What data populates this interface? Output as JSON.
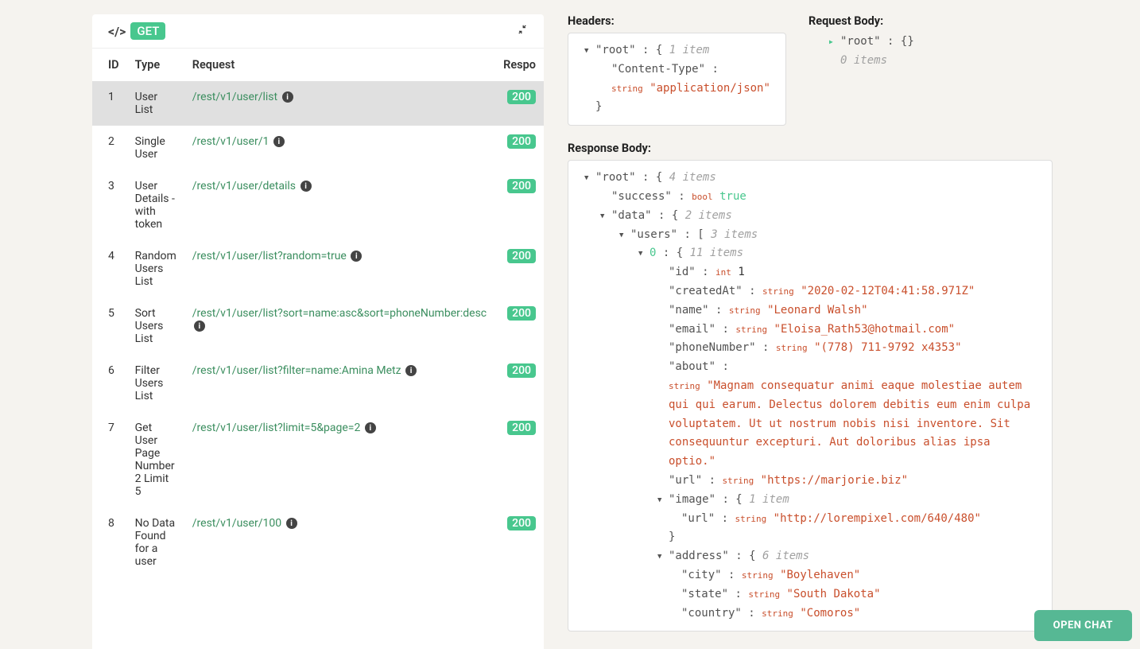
{
  "method_badge": "GET",
  "table": {
    "headers": {
      "id": "ID",
      "type": "Type",
      "request": "Request",
      "response": "Respo"
    },
    "rows": [
      {
        "id": "1",
        "type": "User List",
        "request": "/rest/v1/user/list",
        "response": "200",
        "selected": true
      },
      {
        "id": "2",
        "type": "Single User",
        "request": "/rest/v1/user/1",
        "response": "200"
      },
      {
        "id": "3",
        "type": "User Details - with token",
        "request": "/rest/v1/user/details",
        "response": "200"
      },
      {
        "id": "4",
        "type": "Random Users List",
        "request": "/rest/v1/user/list?random=true",
        "response": "200"
      },
      {
        "id": "5",
        "type": "Sort Users List",
        "request": "/rest/v1/user/list?sort=name:asc&sort=phoneNumber:desc",
        "response": "200"
      },
      {
        "id": "6",
        "type": "Filter Users List",
        "request": "/rest/v1/user/list?filter=name:Amina Metz",
        "response": "200"
      },
      {
        "id": "7",
        "type": "Get User Page Number 2 Limit 5",
        "request": "/rest/v1/user/list?limit=5&page=2",
        "response": "200"
      },
      {
        "id": "8",
        "type": "No Data Found for a user",
        "request": "/rest/v1/user/100",
        "response": "200"
      }
    ]
  },
  "labels": {
    "headers": "Headers:",
    "request_body": "Request Body:",
    "response_body": "Response Body:",
    "open_chat": "OPEN CHAT"
  },
  "headers_panel": {
    "root": "\"root\"",
    "root_items": "1 item",
    "content_type_key": "\"Content-Type\"",
    "content_type_type": "string",
    "content_type_val": "\"application/json\""
  },
  "request_body_panel": {
    "root": "\"root\"",
    "root_brace": "{}",
    "root_items": "0 items"
  },
  "response": {
    "root": "\"root\"",
    "root_items": "4 items",
    "success_key": "\"success\"",
    "success_type": "bool",
    "success_val": "true",
    "data_key": "\"data\"",
    "data_items": "2 items",
    "users_key": "\"users\"",
    "users_items": "3 items",
    "idx0": "0",
    "idx0_items": "11 items",
    "id_key": "\"id\"",
    "id_type": "int",
    "id_val": "1",
    "createdAt_key": "\"createdAt\"",
    "createdAt_val": "\"2020-02-12T04:41:58.971Z\"",
    "name_key": "\"name\"",
    "name_val": "\"Leonard Walsh\"",
    "email_key": "\"email\"",
    "email_val": "\"Eloisa_Rath53@hotmail.com\"",
    "phone_key": "\"phoneNumber\"",
    "phone_val": "\"(778) 711-9792 x4353\"",
    "about_key": "\"about\"",
    "about_val": "\"Magnam consequatur animi eaque molestiae autem qui qui earum. Delectus dolorem debitis eum enim culpa voluptatem. Ut ut nostrum nobis nisi inventore. Sit consequuntur excepturi. Aut doloribus alias ipsa optio.\"",
    "url_key": "\"url\"",
    "url_val": "\"https://marjorie.biz\"",
    "image_key": "\"image\"",
    "image_items": "1 item",
    "image_url_key": "\"url\"",
    "image_url_val": "\"http://lorempixel.com/640/480\"",
    "address_key": "\"address\"",
    "address_items": "6 items",
    "city_key": "\"city\"",
    "city_val": "\"Boylehaven\"",
    "state_key": "\"state\"",
    "state_val": "\"South Dakota\"",
    "country_key": "\"country\"",
    "country_val": "\"Comoros\"",
    "string_type": "string"
  }
}
